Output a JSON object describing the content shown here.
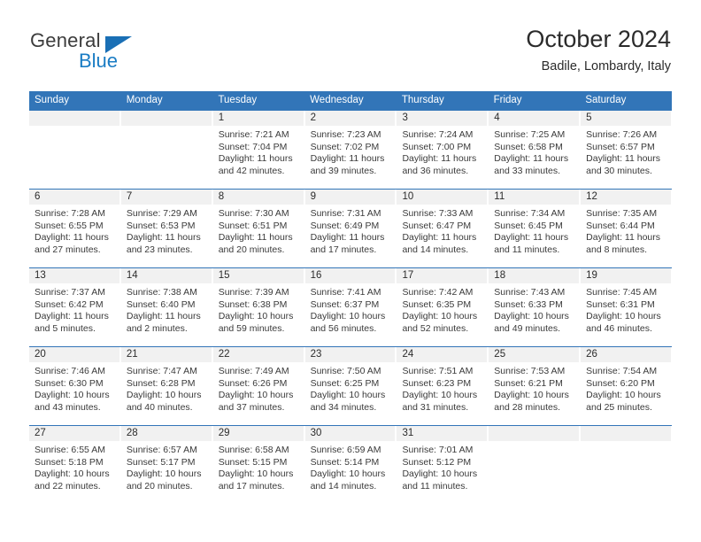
{
  "logo": {
    "name_top": "General",
    "name_bottom": "Blue",
    "triangle_color": "#1a6fb5",
    "text_color": "#3c3c3c",
    "blue_color": "#1a7cc4"
  },
  "header": {
    "title": "October 2024",
    "subtitle": "Badile, Lombardy, Italy"
  },
  "theme": {
    "header_blue": "#3275b8",
    "day_band_gray": "#f1f1f1",
    "text_dark": "#2b2b2b"
  },
  "weekdays": [
    "Sunday",
    "Monday",
    "Tuesday",
    "Wednesday",
    "Thursday",
    "Friday",
    "Saturday"
  ],
  "weeks": [
    [
      {
        "day": "",
        "sunrise": "",
        "sunset": "",
        "daylight_1": "",
        "daylight_2": ""
      },
      {
        "day": "",
        "sunrise": "",
        "sunset": "",
        "daylight_1": "",
        "daylight_2": ""
      },
      {
        "day": "1",
        "sunrise": "Sunrise: 7:21 AM",
        "sunset": "Sunset: 7:04 PM",
        "daylight_1": "Daylight: 11 hours",
        "daylight_2": "and 42 minutes."
      },
      {
        "day": "2",
        "sunrise": "Sunrise: 7:23 AM",
        "sunset": "Sunset: 7:02 PM",
        "daylight_1": "Daylight: 11 hours",
        "daylight_2": "and 39 minutes."
      },
      {
        "day": "3",
        "sunrise": "Sunrise: 7:24 AM",
        "sunset": "Sunset: 7:00 PM",
        "daylight_1": "Daylight: 11 hours",
        "daylight_2": "and 36 minutes."
      },
      {
        "day": "4",
        "sunrise": "Sunrise: 7:25 AM",
        "sunset": "Sunset: 6:58 PM",
        "daylight_1": "Daylight: 11 hours",
        "daylight_2": "and 33 minutes."
      },
      {
        "day": "5",
        "sunrise": "Sunrise: 7:26 AM",
        "sunset": "Sunset: 6:57 PM",
        "daylight_1": "Daylight: 11 hours",
        "daylight_2": "and 30 minutes."
      }
    ],
    [
      {
        "day": "6",
        "sunrise": "Sunrise: 7:28 AM",
        "sunset": "Sunset: 6:55 PM",
        "daylight_1": "Daylight: 11 hours",
        "daylight_2": "and 27 minutes."
      },
      {
        "day": "7",
        "sunrise": "Sunrise: 7:29 AM",
        "sunset": "Sunset: 6:53 PM",
        "daylight_1": "Daylight: 11 hours",
        "daylight_2": "and 23 minutes."
      },
      {
        "day": "8",
        "sunrise": "Sunrise: 7:30 AM",
        "sunset": "Sunset: 6:51 PM",
        "daylight_1": "Daylight: 11 hours",
        "daylight_2": "and 20 minutes."
      },
      {
        "day": "9",
        "sunrise": "Sunrise: 7:31 AM",
        "sunset": "Sunset: 6:49 PM",
        "daylight_1": "Daylight: 11 hours",
        "daylight_2": "and 17 minutes."
      },
      {
        "day": "10",
        "sunrise": "Sunrise: 7:33 AM",
        "sunset": "Sunset: 6:47 PM",
        "daylight_1": "Daylight: 11 hours",
        "daylight_2": "and 14 minutes."
      },
      {
        "day": "11",
        "sunrise": "Sunrise: 7:34 AM",
        "sunset": "Sunset: 6:45 PM",
        "daylight_1": "Daylight: 11 hours",
        "daylight_2": "and 11 minutes."
      },
      {
        "day": "12",
        "sunrise": "Sunrise: 7:35 AM",
        "sunset": "Sunset: 6:44 PM",
        "daylight_1": "Daylight: 11 hours",
        "daylight_2": "and 8 minutes."
      }
    ],
    [
      {
        "day": "13",
        "sunrise": "Sunrise: 7:37 AM",
        "sunset": "Sunset: 6:42 PM",
        "daylight_1": "Daylight: 11 hours",
        "daylight_2": "and 5 minutes."
      },
      {
        "day": "14",
        "sunrise": "Sunrise: 7:38 AM",
        "sunset": "Sunset: 6:40 PM",
        "daylight_1": "Daylight: 11 hours",
        "daylight_2": "and 2 minutes."
      },
      {
        "day": "15",
        "sunrise": "Sunrise: 7:39 AM",
        "sunset": "Sunset: 6:38 PM",
        "daylight_1": "Daylight: 10 hours",
        "daylight_2": "and 59 minutes."
      },
      {
        "day": "16",
        "sunrise": "Sunrise: 7:41 AM",
        "sunset": "Sunset: 6:37 PM",
        "daylight_1": "Daylight: 10 hours",
        "daylight_2": "and 56 minutes."
      },
      {
        "day": "17",
        "sunrise": "Sunrise: 7:42 AM",
        "sunset": "Sunset: 6:35 PM",
        "daylight_1": "Daylight: 10 hours",
        "daylight_2": "and 52 minutes."
      },
      {
        "day": "18",
        "sunrise": "Sunrise: 7:43 AM",
        "sunset": "Sunset: 6:33 PM",
        "daylight_1": "Daylight: 10 hours",
        "daylight_2": "and 49 minutes."
      },
      {
        "day": "19",
        "sunrise": "Sunrise: 7:45 AM",
        "sunset": "Sunset: 6:31 PM",
        "daylight_1": "Daylight: 10 hours",
        "daylight_2": "and 46 minutes."
      }
    ],
    [
      {
        "day": "20",
        "sunrise": "Sunrise: 7:46 AM",
        "sunset": "Sunset: 6:30 PM",
        "daylight_1": "Daylight: 10 hours",
        "daylight_2": "and 43 minutes."
      },
      {
        "day": "21",
        "sunrise": "Sunrise: 7:47 AM",
        "sunset": "Sunset: 6:28 PM",
        "daylight_1": "Daylight: 10 hours",
        "daylight_2": "and 40 minutes."
      },
      {
        "day": "22",
        "sunrise": "Sunrise: 7:49 AM",
        "sunset": "Sunset: 6:26 PM",
        "daylight_1": "Daylight: 10 hours",
        "daylight_2": "and 37 minutes."
      },
      {
        "day": "23",
        "sunrise": "Sunrise: 7:50 AM",
        "sunset": "Sunset: 6:25 PM",
        "daylight_1": "Daylight: 10 hours",
        "daylight_2": "and 34 minutes."
      },
      {
        "day": "24",
        "sunrise": "Sunrise: 7:51 AM",
        "sunset": "Sunset: 6:23 PM",
        "daylight_1": "Daylight: 10 hours",
        "daylight_2": "and 31 minutes."
      },
      {
        "day": "25",
        "sunrise": "Sunrise: 7:53 AM",
        "sunset": "Sunset: 6:21 PM",
        "daylight_1": "Daylight: 10 hours",
        "daylight_2": "and 28 minutes."
      },
      {
        "day": "26",
        "sunrise": "Sunrise: 7:54 AM",
        "sunset": "Sunset: 6:20 PM",
        "daylight_1": "Daylight: 10 hours",
        "daylight_2": "and 25 minutes."
      }
    ],
    [
      {
        "day": "27",
        "sunrise": "Sunrise: 6:55 AM",
        "sunset": "Sunset: 5:18 PM",
        "daylight_1": "Daylight: 10 hours",
        "daylight_2": "and 22 minutes."
      },
      {
        "day": "28",
        "sunrise": "Sunrise: 6:57 AM",
        "sunset": "Sunset: 5:17 PM",
        "daylight_1": "Daylight: 10 hours",
        "daylight_2": "and 20 minutes."
      },
      {
        "day": "29",
        "sunrise": "Sunrise: 6:58 AM",
        "sunset": "Sunset: 5:15 PM",
        "daylight_1": "Daylight: 10 hours",
        "daylight_2": "and 17 minutes."
      },
      {
        "day": "30",
        "sunrise": "Sunrise: 6:59 AM",
        "sunset": "Sunset: 5:14 PM",
        "daylight_1": "Daylight: 10 hours",
        "daylight_2": "and 14 minutes."
      },
      {
        "day": "31",
        "sunrise": "Sunrise: 7:01 AM",
        "sunset": "Sunset: 5:12 PM",
        "daylight_1": "Daylight: 10 hours",
        "daylight_2": "and 11 minutes."
      },
      {
        "day": "",
        "sunrise": "",
        "sunset": "",
        "daylight_1": "",
        "daylight_2": ""
      },
      {
        "day": "",
        "sunrise": "",
        "sunset": "",
        "daylight_1": "",
        "daylight_2": ""
      }
    ]
  ]
}
